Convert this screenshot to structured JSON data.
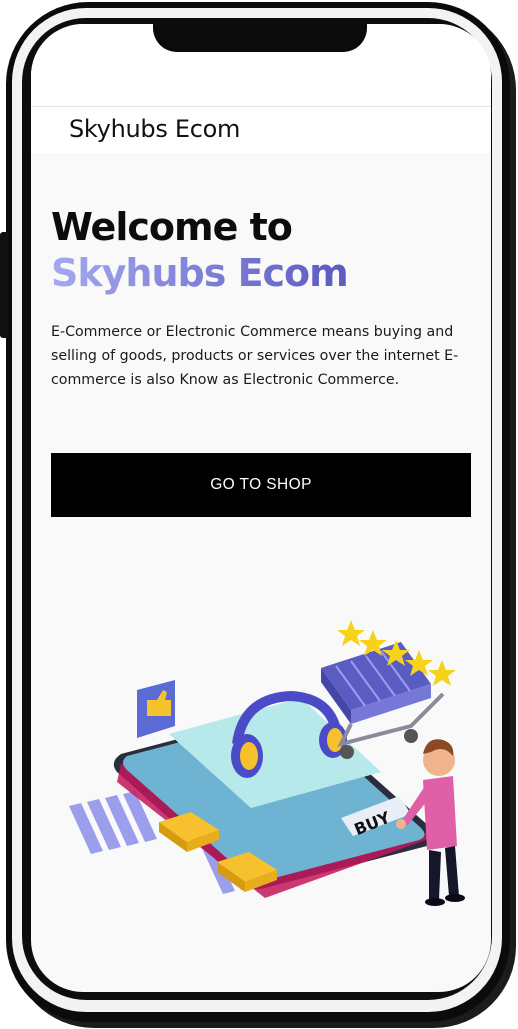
{
  "app": {
    "brand": "Skyhubs Ecom"
  },
  "hero": {
    "title_line1": "Welcome to",
    "title_line2": "Skyhubs Ecom",
    "description": "E-Commerce or Electronic Commerce means buying and selling of goods, products or services over the internet E-commerce is also Know as Electronic Commerce.",
    "cta_label": "GO TO SHOP",
    "illustration_label": "BUY"
  },
  "colors": {
    "accent_gradient_start": "#a4a9ee",
    "accent_gradient_end": "#5a5ac0",
    "cta_background": "#000000",
    "screen_background": "#f9f9f9"
  },
  "icons": [
    "like-icon",
    "shopping-cart-icon",
    "star-icon",
    "headphones-icon"
  ]
}
